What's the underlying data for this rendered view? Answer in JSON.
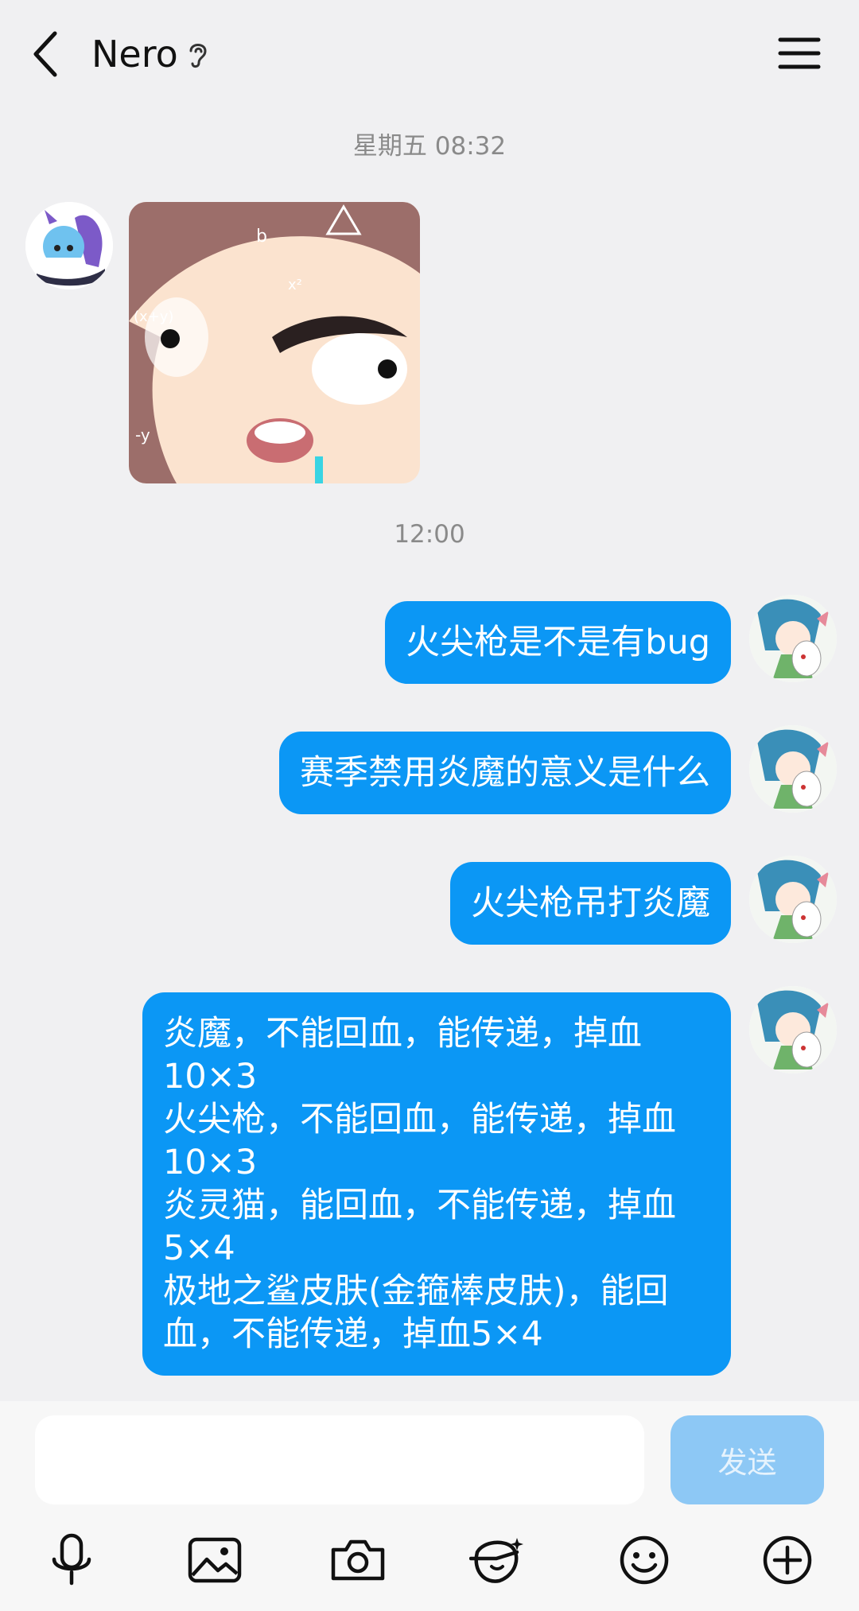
{
  "header": {
    "title": "Nero"
  },
  "timestamps": [
    "星期五 08:32",
    "12:00"
  ],
  "messages": [
    {
      "text": "火尖枪是不是有bug"
    },
    {
      "text": "赛季禁用炎魔的意义是什么"
    },
    {
      "text": "火尖枪吊打炎魔"
    },
    {
      "lines": [
        "炎魔，不能回血，能传递，掉血",
        "10×3",
        "火尖枪，不能回血，能传递，掉血",
        "10×3",
        "炎灵猫，能回血，不能传递，掉血",
        "5×4",
        "极地之鲨皮肤(金箍棒皮肤)，能回",
        "血，不能传递，掉血5×4"
      ]
    }
  ],
  "composer": {
    "input_value": "",
    "send_label": "发送"
  },
  "icons": [
    "back-arrow-icon",
    "ear-icon",
    "menu-icon",
    "microphone-icon",
    "image-icon",
    "camera-icon",
    "sticker-icon",
    "emoji-icon",
    "plus-icon"
  ],
  "colors": {
    "bubble": "#0b97f5",
    "send_disabled": "#8dc8f5",
    "background": "#f0f0f2"
  }
}
